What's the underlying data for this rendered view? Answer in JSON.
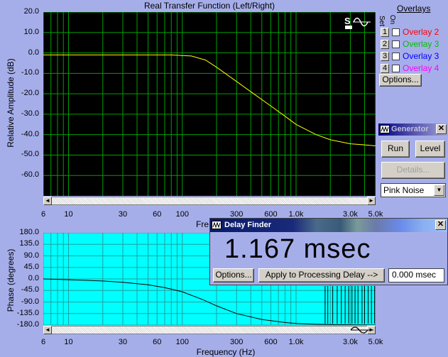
{
  "top_chart": {
    "title": "Real Transfer Function (Left/Right)",
    "ylabel": "Relative Amplitude (dB)",
    "xlabel_partial": "Fre",
    "y_ticks": [
      "20.0",
      "10.0",
      "0.0",
      "-10.0",
      "-20.0",
      "-30.0",
      "-40.0",
      "-50.0",
      "-60.0"
    ],
    "x_ticks": [
      "6",
      "10",
      "30",
      "60",
      "100",
      "300",
      "600",
      "1.0k",
      "3.0k",
      "5.0k"
    ],
    "line_color": "#ffff00",
    "plot_bg": "#000000",
    "grid_color": "#00a000"
  },
  "bottom_chart": {
    "ylabel": "Phase (degrees)",
    "xlabel": "Frequency (Hz)",
    "y_ticks": [
      "180.0",
      "135.0",
      "90.0",
      "45.0",
      "0.0",
      "-45.0",
      "-90.0",
      "-135.0",
      "-180.0"
    ],
    "x_ticks": [
      "6",
      "10",
      "30",
      "60",
      "100",
      "300",
      "600",
      "1.0k",
      "3.0k",
      "5.0k"
    ],
    "line_color": "#000000",
    "plot_bg": "#00ffff"
  },
  "chart_data": [
    {
      "type": "line",
      "title": "Real Transfer Function (Left/Right)",
      "xlabel": "Frequency (Hz)",
      "ylabel": "Relative Amplitude (dB)",
      "x_scale": "log",
      "xlim": [
        6,
        5000
      ],
      "ylim": [
        -70,
        20
      ],
      "grid": true,
      "series": [
        {
          "x": [
            6,
            10,
            20,
            40,
            80,
            120,
            160,
            200,
            300,
            400,
            600,
            800,
            1000,
            1500,
            2000,
            3000,
            4000,
            5000
          ],
          "y": [
            -1.0,
            -1.0,
            -1.0,
            -1.0,
            -1.0,
            -1.5,
            -3.5,
            -7,
            -14,
            -19,
            -26,
            -31,
            -35,
            -40,
            -42.5,
            -44.5,
            -45,
            -45.5
          ]
        }
      ]
    },
    {
      "type": "line",
      "xlabel": "Frequency (Hz)",
      "ylabel": "Phase (degrees)",
      "x_scale": "log",
      "xlim": [
        6,
        5000
      ],
      "ylim": [
        -180,
        180
      ],
      "grid": true,
      "series": [
        {
          "x": [
            6,
            10,
            20,
            30,
            50,
            70,
            100,
            150,
            200,
            300,
            500,
            800,
            1000,
            1500,
            2000,
            3000,
            5000
          ],
          "y": [
            0,
            -3,
            -8,
            -13,
            -23,
            -34,
            -50,
            -80,
            -105,
            -135,
            -158,
            -170,
            -174,
            -177,
            -178,
            -179,
            -180
          ]
        }
      ]
    }
  ],
  "overlays": {
    "header": "Overlays",
    "col_set": "Set",
    "col_on": "On",
    "items": [
      {
        "num": "1",
        "label": "Overlay 2",
        "color": "#ff0000"
      },
      {
        "num": "2",
        "label": "Overlay 3",
        "color": "#00c000"
      },
      {
        "num": "3",
        "label": "Overlay 3",
        "color": "#0000ff"
      },
      {
        "num": "4",
        "label": "Overlay 4",
        "color": "#ff00ff"
      }
    ],
    "options_label": "Options..."
  },
  "generator": {
    "title": "Generator",
    "run_label": "Run",
    "level_label": "Level",
    "details_label": "Details...",
    "signal_selected": "Pink Noise"
  },
  "delay_finder": {
    "title": "Delay Finder",
    "value": "1.167 msec",
    "options_label": "Options...",
    "apply_label": "Apply to Processing Delay -->",
    "field_value": "0.000 msec"
  }
}
